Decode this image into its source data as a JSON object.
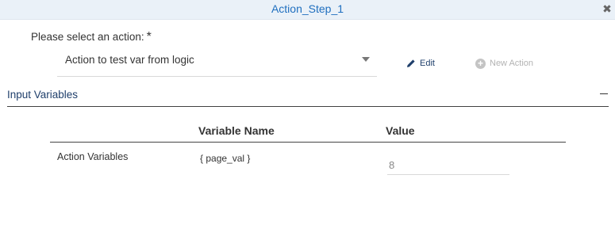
{
  "dialog": {
    "title": "Action_Step_1",
    "close_icon": "close-icon"
  },
  "action_select": {
    "prompt": "Please select an action:",
    "required_mark": "*",
    "selected_value": "Action to test var from logic"
  },
  "actions": {
    "edit_label": "Edit",
    "new_action_label": "New Action"
  },
  "input_variables": {
    "section_title": "Input Variables",
    "columns": [
      "Variable Name",
      "Value"
    ],
    "rows": [
      {
        "label": "Action Variables",
        "variable_name": "{ page_val }",
        "value": "8"
      }
    ]
  },
  "colors": {
    "accent": "#1f6fbf",
    "header_bg": "#eaf1f8",
    "link": "#1f3f6b",
    "disabled": "#b3b3b3"
  }
}
